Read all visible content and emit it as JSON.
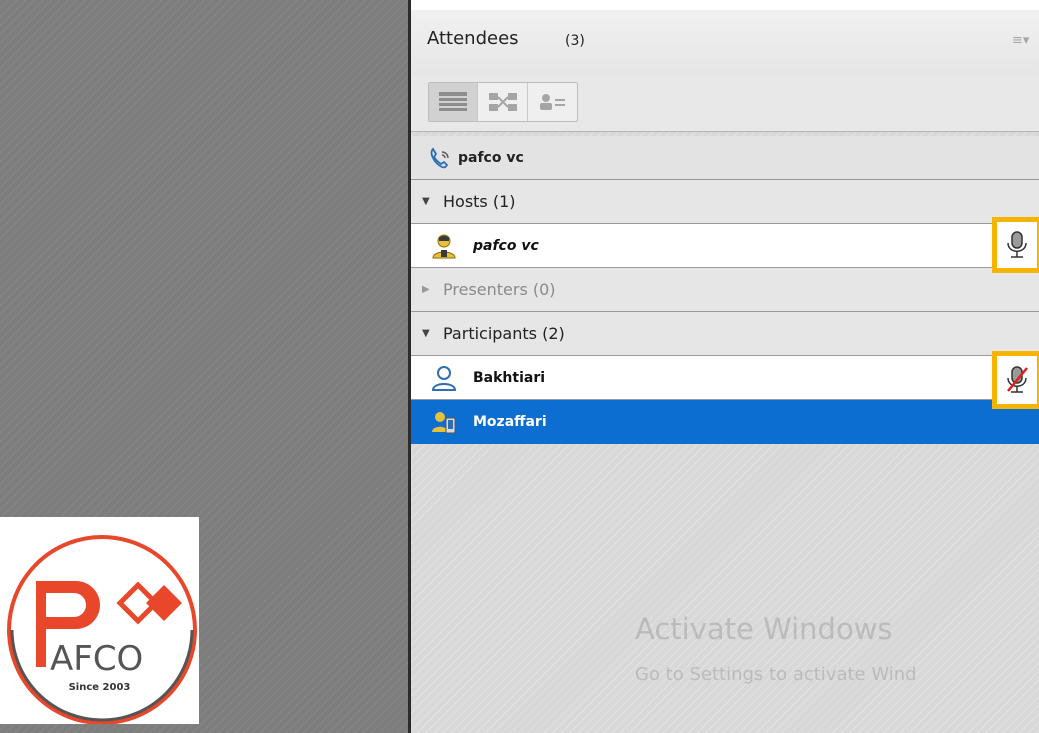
{
  "panel": {
    "title": "Attendees",
    "count": "(3)",
    "menu_icon": "list-menu-icon"
  },
  "toolbar": {
    "views": [
      "list-view-icon",
      "breakout-view-icon",
      "role-view-icon"
    ],
    "active_view": "list-view-icon"
  },
  "conference": {
    "label": "pafco vc",
    "icon": "phone-call-icon"
  },
  "sections": {
    "hosts": "Hosts (1)",
    "presenters": "Presenters (0)",
    "participants": "Participants (2)"
  },
  "attendees": {
    "host": {
      "name": "pafco vc",
      "icon": "host-user-icon",
      "mic": "microphone-icon"
    },
    "participant1": {
      "name": "Bakhtiari",
      "icon": "participant-user-icon",
      "mic": "microphone-muted-icon"
    },
    "participant2": {
      "name": "Mozaffari",
      "icon": "mobile-user-icon"
    }
  },
  "logo": {
    "brand": "AFCO",
    "since": "Since 2003"
  },
  "watermark": {
    "line1": "Activate Windows",
    "line2": "Go to Settings to activate Wind"
  },
  "colors": {
    "selection": "#0b6ed0",
    "highlight_box": "#f4b400",
    "logo_red": "#e8472a"
  }
}
